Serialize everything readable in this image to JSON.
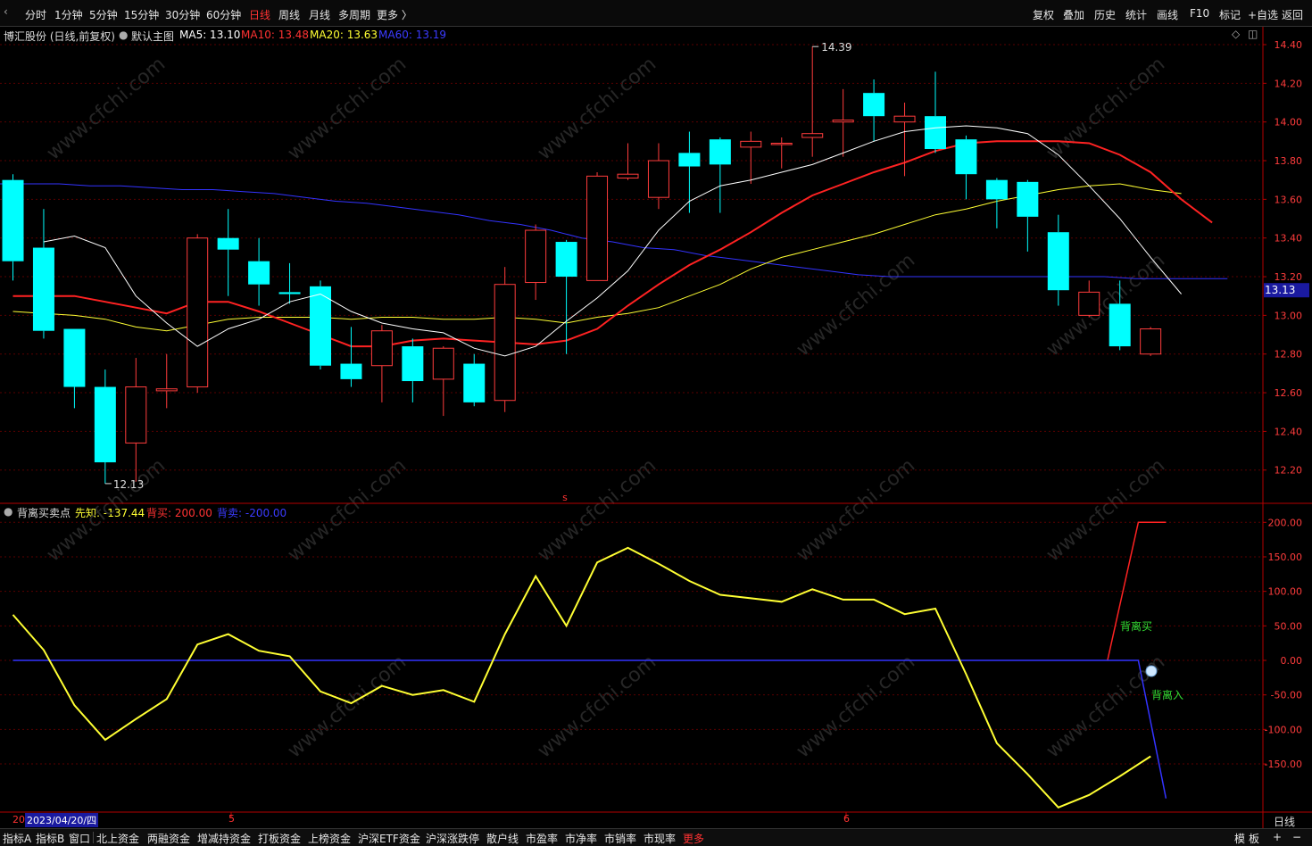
{
  "periods": [
    "分时",
    "1分钟",
    "5分钟",
    "15分钟",
    "30分钟",
    "60分钟",
    "日线",
    "周线",
    "月线",
    "多周期",
    "更多 〉"
  ],
  "active_period": "日线",
  "right_tools": [
    "复权",
    "叠加",
    "历史",
    "统计",
    "画线",
    "F10",
    "标记",
    "+自选",
    "返回"
  ],
  "main": {
    "title": "博汇股份 (日线,前复权)",
    "template": "默认主图",
    "ma5": {
      "label": "MA5: 13.10",
      "color": "#ffffff"
    },
    "ma10": {
      "label": "MA10: 13.48",
      "color": "#ff2222"
    },
    "ma20": {
      "label": "MA20: 13.63",
      "color": "#ffff33"
    },
    "ma60": {
      "label": "MA60: 13.19",
      "color": "#3333ff"
    },
    "high_mark": "14.39",
    "low_mark": "12.13",
    "last_price": "13.13",
    "s_marker": "s"
  },
  "sub": {
    "name": "背离买卖点",
    "xianzhi": {
      "label": "先知: -137.44",
      "color": "#ffff33"
    },
    "beimai": {
      "label": "背买: 200.00",
      "color": "#ff2222"
    },
    "beimai_sell": {
      "label": "背卖: -200.00",
      "color": "#3333ff"
    },
    "tag_buy": "背离买",
    "tag_in": "背离入"
  },
  "date_axis": {
    "prefix": "20",
    "cursor_date": "2023/04/20/四",
    "month5": "5",
    "month6": "6",
    "period_label": "日线"
  },
  "bottom_tabs": [
    "指标A",
    "指标B",
    "窗口",
    "北上资金",
    "两融资金",
    "增减持资金",
    "打板资金",
    "上榜资金",
    "沪深ETF资金",
    "沪深涨跌停",
    "散户线",
    "市盈率",
    "市净率",
    "市销率",
    "市现率",
    "更多"
  ],
  "bottom_right": [
    "模",
    "板",
    "+",
    "−"
  ],
  "watermark": "www.cfchi.com",
  "colors": {
    "up": "#ff3c3c",
    "down": "#00ffff",
    "grid": "#5a0000",
    "axis": "#b40000"
  },
  "chart_data": [
    {
      "type": "candlestick",
      "ylim": [
        12.05,
        14.5
      ],
      "y_ticks": [
        "14.40",
        "14.20",
        "14.00",
        "13.80",
        "13.60",
        "13.40",
        "13.20",
        "13.00",
        "12.80",
        "12.60",
        "12.40",
        "12.20"
      ],
      "candles": [
        {
          "o": 13.7,
          "c": 13.28,
          "h": 13.73,
          "l": 13.18
        },
        {
          "o": 13.35,
          "c": 12.92,
          "h": 13.55,
          "l": 12.88
        },
        {
          "o": 12.93,
          "c": 12.63,
          "h": 12.93,
          "l": 12.52
        },
        {
          "o": 12.63,
          "c": 12.24,
          "h": 12.72,
          "l": 12.13
        },
        {
          "o": 12.34,
          "c": 12.63,
          "h": 12.78,
          "l": 12.14
        },
        {
          "o": 12.61,
          "c": 12.62,
          "h": 12.8,
          "l": 12.52
        },
        {
          "o": 12.63,
          "c": 13.4,
          "h": 13.42,
          "l": 12.6
        },
        {
          "o": 13.4,
          "c": 13.34,
          "h": 13.55,
          "l": 13.1
        },
        {
          "o": 13.28,
          "c": 13.16,
          "h": 13.4,
          "l": 13.05
        },
        {
          "o": 13.12,
          "c": 13.11,
          "h": 13.27,
          "l": 13.06
        },
        {
          "o": 13.15,
          "c": 12.74,
          "h": 13.18,
          "l": 12.72
        },
        {
          "o": 12.75,
          "c": 12.67,
          "h": 12.94,
          "l": 12.63
        },
        {
          "o": 12.74,
          "c": 12.92,
          "h": 12.95,
          "l": 12.55
        },
        {
          "o": 12.84,
          "c": 12.66,
          "h": 12.88,
          "l": 12.55
        },
        {
          "o": 12.67,
          "c": 12.83,
          "h": 12.84,
          "l": 12.48
        },
        {
          "o": 12.75,
          "c": 12.55,
          "h": 12.8,
          "l": 12.53
        },
        {
          "o": 12.56,
          "c": 13.16,
          "h": 13.25,
          "l": 12.5
        },
        {
          "o": 13.17,
          "c": 13.44,
          "h": 13.47,
          "l": 13.08
        },
        {
          "o": 13.38,
          "c": 13.2,
          "h": 13.39,
          "l": 12.8
        },
        {
          "o": 13.18,
          "c": 13.72,
          "h": 13.74,
          "l": 13.18
        },
        {
          "o": 13.71,
          "c": 13.73,
          "h": 13.89,
          "l": 13.7
        },
        {
          "o": 13.61,
          "c": 13.8,
          "h": 13.89,
          "l": 13.55
        },
        {
          "o": 13.84,
          "c": 13.77,
          "h": 13.95,
          "l": 13.53
        },
        {
          "o": 13.91,
          "c": 13.78,
          "h": 13.92,
          "l": 13.53
        },
        {
          "o": 13.87,
          "c": 13.9,
          "h": 13.95,
          "l": 13.68
        },
        {
          "o": 13.89,
          "c": 13.89,
          "h": 13.92,
          "l": 13.76
        },
        {
          "o": 13.92,
          "c": 13.94,
          "h": 14.39,
          "l": 13.82
        },
        {
          "o": 14.0,
          "c": 14.01,
          "h": 14.17,
          "l": 13.82
        },
        {
          "o": 14.15,
          "c": 14.03,
          "h": 14.22,
          "l": 13.9
        },
        {
          "o": 14.0,
          "c": 14.03,
          "h": 14.1,
          "l": 13.72
        },
        {
          "o": 14.03,
          "c": 13.86,
          "h": 14.26,
          "l": 13.84
        },
        {
          "o": 13.91,
          "c": 13.73,
          "h": 13.93,
          "l": 13.6
        },
        {
          "o": 13.7,
          "c": 13.6,
          "h": 13.71,
          "l": 13.45
        },
        {
          "o": 13.69,
          "c": 13.51,
          "h": 13.7,
          "l": 13.33
        },
        {
          "o": 13.43,
          "c": 13.13,
          "h": 13.52,
          "l": 13.05
        },
        {
          "o": 13.0,
          "c": 13.12,
          "h": 13.18,
          "l": 12.99
        },
        {
          "o": 13.06,
          "c": 12.84,
          "h": 13.18,
          "l": 12.82
        },
        {
          "o": 12.8,
          "c": 12.93,
          "h": 12.94,
          "l": 12.79
        }
      ],
      "ma5": [
        13.38,
        13.41,
        13.35,
        13.1,
        12.96,
        12.84,
        12.93,
        12.98,
        13.07,
        13.11,
        13.02,
        12.96,
        12.93,
        12.91,
        12.83,
        12.79,
        12.84,
        12.97,
        13.09,
        13.23,
        13.44,
        13.59,
        13.67,
        13.7,
        13.74,
        13.78,
        13.84,
        13.9,
        13.95,
        13.97,
        13.98,
        13.97,
        13.94,
        13.83,
        13.67,
        13.5,
        13.3,
        13.11
      ],
      "ma10": [
        13.1,
        13.1,
        13.1,
        13.07,
        13.04,
        13.01,
        13.07,
        13.07,
        13.02,
        12.96,
        12.9,
        12.84,
        12.84,
        12.87,
        12.88,
        12.87,
        12.86,
        12.85,
        12.87,
        12.93,
        13.05,
        13.16,
        13.26,
        13.34,
        13.43,
        13.53,
        13.62,
        13.68,
        13.74,
        13.79,
        13.85,
        13.89,
        13.9,
        13.9,
        13.9,
        13.89,
        13.83,
        13.74,
        13.6,
        13.48
      ],
      "ma20": [
        13.02,
        13.01,
        13.0,
        12.98,
        12.94,
        12.92,
        12.95,
        12.98,
        12.99,
        12.99,
        12.99,
        12.98,
        12.99,
        12.99,
        12.98,
        12.98,
        12.99,
        12.98,
        12.96,
        12.99,
        13.01,
        13.04,
        13.1,
        13.16,
        13.24,
        13.3,
        13.34,
        13.38,
        13.42,
        13.47,
        13.52,
        13.55,
        13.59,
        13.62,
        13.65,
        13.67,
        13.68,
        13.65,
        13.63
      ],
      "ma60": [
        13.68,
        13.68,
        13.68,
        13.67,
        13.67,
        13.66,
        13.65,
        13.65,
        13.64,
        13.63,
        13.61,
        13.59,
        13.58,
        13.56,
        13.54,
        13.52,
        13.49,
        13.47,
        13.44,
        13.4,
        13.38,
        13.35,
        13.34,
        13.31,
        13.29,
        13.27,
        13.25,
        13.23,
        13.21,
        13.2,
        13.2,
        13.2,
        13.2,
        13.2,
        13.2,
        13.2,
        13.2,
        13.19,
        13.19,
        13.19,
        13.19
      ]
    },
    {
      "type": "line",
      "ylim": [
        -215,
        215
      ],
      "y_ticks": [
        "200.00",
        "150.00",
        "100.00",
        "50.00",
        "0.00",
        "-50.00",
        "-100.00",
        "-150.00"
      ],
      "series": [
        {
          "name": "先知",
          "color": "#ffff33",
          "values": [
            66,
            15,
            -65,
            -115,
            -85,
            -56,
            23,
            38,
            14,
            6,
            -45,
            -62,
            -37,
            -50,
            -43,
            -60,
            38,
            122,
            50,
            142,
            163,
            140,
            115,
            95,
            90,
            85,
            103,
            88,
            88,
            67,
            75,
            -20,
            -120,
            -165,
            -213,
            -195,
            -168,
            -139
          ]
        },
        {
          "name": "背买",
          "color": "#ff2222",
          "values": [
            0,
            0,
            0,
            0,
            0,
            0,
            0,
            0,
            0,
            0,
            0,
            0,
            0,
            0,
            0,
            0,
            0,
            0,
            0,
            0,
            0,
            0,
            0,
            0,
            0,
            0,
            0,
            0,
            0,
            0,
            0,
            0,
            0,
            0,
            0,
            0,
            200,
            200
          ]
        },
        {
          "name": "背卖",
          "color": "#3333ff",
          "values": [
            0,
            0,
            0,
            0,
            0,
            0,
            0,
            0,
            0,
            0,
            0,
            0,
            0,
            0,
            0,
            0,
            0,
            0,
            0,
            0,
            0,
            0,
            0,
            0,
            0,
            0,
            0,
            0,
            0,
            0,
            0,
            0,
            0,
            0,
            0,
            0,
            -200,
            -200
          ]
        }
      ]
    }
  ]
}
